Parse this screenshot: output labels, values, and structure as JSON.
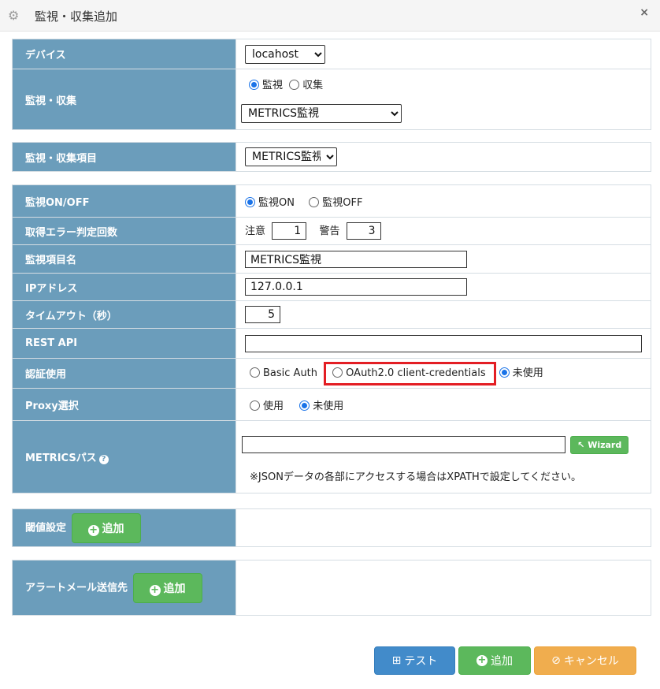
{
  "dialog": {
    "title": "監視・収集追加",
    "close_label": "×"
  },
  "device": {
    "label": "デバイス",
    "value": "locahost"
  },
  "monitor_collect": {
    "label": "監視・収集",
    "radio_monitor": "監視",
    "radio_collect": "収集",
    "type_value": "METRICS監視"
  },
  "item": {
    "label": "監視・収集項目",
    "value": "METRICS監視"
  },
  "monitor_onoff": {
    "label": "監視ON/OFF",
    "on": "監視ON",
    "off": "監視OFF"
  },
  "error_count": {
    "label": "取得エラー判定回数",
    "caution_label": "注意",
    "caution_value": "1",
    "warning_label": "警告",
    "warning_value": "3"
  },
  "item_name": {
    "label": "監視項目名",
    "value": "METRICS監視"
  },
  "ip": {
    "label": "IPアドレス",
    "value": "127.0.0.1"
  },
  "timeout": {
    "label": "タイムアウト（秒）",
    "value": "5"
  },
  "rest_api": {
    "label": "REST API",
    "value": ""
  },
  "auth": {
    "label": "認証使用",
    "basic": "Basic Auth",
    "oauth": "OAuth2.0 client-credentials",
    "none": "未使用",
    "highlight_color": "#e31e24"
  },
  "proxy": {
    "label": "Proxy選択",
    "use": "使用",
    "none": "未使用"
  },
  "metrics_path": {
    "label": "METRICSパス",
    "help_icon": "?",
    "value": "",
    "wizard_label": "Wizard",
    "note": "※JSONデータの各部にアクセスする場合はXPATHで設定してください。"
  },
  "threshold": {
    "label": "閾値設定",
    "add_label": "追加"
  },
  "alert_mail": {
    "label": "アラートメール送信先",
    "add_label": "追加"
  },
  "footer": {
    "test_label": "テスト",
    "add_label": "追加",
    "cancel_label": "キャンセル"
  },
  "colors": {
    "label_bg": "#6b9dbb",
    "green": "#5cb85c",
    "blue": "#428bca",
    "orange": "#f0ad4e"
  }
}
